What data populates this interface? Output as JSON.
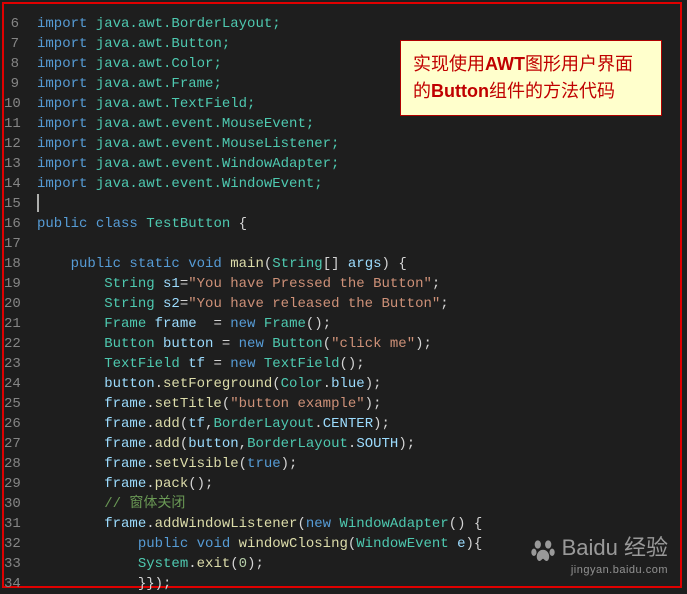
{
  "gutter": {
    "start": 6,
    "end": 34
  },
  "callout": {
    "seg1": "实现使用",
    "bold1": "AWT",
    "seg2": "图形用户界面的",
    "bold2": "Button",
    "seg3": "组件的方法代码"
  },
  "watermark": {
    "brand": "Baidu 经验",
    "sub": "jingyan.baidu.com"
  },
  "code": {
    "l6": {
      "a": "import",
      "b": " java.awt.BorderLayout;"
    },
    "l7": {
      "a": "import",
      "b": " java.awt.Button;"
    },
    "l8": {
      "a": "import",
      "b": " java.awt.Color;"
    },
    "l9": {
      "a": "import",
      "b": " java.awt.Frame;"
    },
    "l10": {
      "a": "import",
      "b": " java.awt.TextField;"
    },
    "l11": {
      "a": "import",
      "b": " java.awt.event.MouseEvent;"
    },
    "l12": {
      "a": "import",
      "b": " java.awt.event.MouseListener;"
    },
    "l13": {
      "a": "import",
      "b": " java.awt.event.WindowAdapter;"
    },
    "l14": {
      "a": "import",
      "b": " java.awt.event.WindowEvent;"
    },
    "l16": {
      "a": "public",
      "b": " class",
      "c": " TestButton",
      "d": " {"
    },
    "l18": {
      "a": "    public",
      "b": " static",
      "c": " void",
      "d": " main",
      "e": "(",
      "f": "String",
      "g": "[] ",
      "h": "args",
      "i": ") {"
    },
    "l19": {
      "a": "        String",
      "b": " s1",
      "c": "=",
      "d": "\"You have Pressed the Button\"",
      "e": ";"
    },
    "l20": {
      "a": "        String",
      "b": " s2",
      "c": "=",
      "d": "\"You have released the Button\"",
      "e": ";"
    },
    "l21": {
      "a": "        Frame",
      "b": " frame",
      "c": "  = ",
      "d": "new",
      "e": " Frame",
      "f": "();"
    },
    "l22": {
      "a": "        Button",
      "b": " button",
      "c": " = ",
      "d": "new",
      "e": " Button",
      "f": "(",
      "g": "\"click me\"",
      "h": ");"
    },
    "l23": {
      "a": "        TextField",
      "b": " tf",
      "c": " = ",
      "d": "new",
      "e": " TextField",
      "f": "();"
    },
    "l24": {
      "a": "        button",
      "b": ".",
      "c": "setForeground",
      "d": "(",
      "e": "Color",
      "f": ".",
      "g": "blue",
      "h": ");"
    },
    "l25": {
      "a": "        frame",
      "b": ".",
      "c": "setTitle",
      "d": "(",
      "e": "\"button example\"",
      "f": ");"
    },
    "l26": {
      "a": "        frame",
      "b": ".",
      "c": "add",
      "d": "(",
      "e": "tf",
      "f": ",",
      "g": "BorderLayout",
      "h": ".",
      "i": "CENTER",
      "j": ");"
    },
    "l27": {
      "a": "        frame",
      "b": ".",
      "c": "add",
      "d": "(",
      "e": "button",
      "f": ",",
      "g": "BorderLayout",
      "h": ".",
      "i": "SOUTH",
      "j": ");"
    },
    "l28": {
      "a": "        frame",
      "b": ".",
      "c": "setVisible",
      "d": "(",
      "e": "true",
      "f": ");"
    },
    "l29": {
      "a": "        frame",
      "b": ".",
      "c": "pack",
      "d": "();"
    },
    "l30": {
      "a": "        // 窗体关闭"
    },
    "l31": {
      "a": "        frame",
      "b": ".",
      "c": "addWindowListener",
      "d": "(",
      "e": "new",
      "f": " WindowAdapter",
      "g": "() {"
    },
    "l32": {
      "a": "            public",
      "b": " void",
      "c": " windowClosing",
      "d": "(",
      "e": "WindowEvent",
      "f": " e",
      "g": "){"
    },
    "l33": {
      "a": "            System",
      "b": ".",
      "c": "exit",
      "d": "(",
      "e": "0",
      "f": ");"
    },
    "l34": {
      "a": "            }});"
    }
  }
}
